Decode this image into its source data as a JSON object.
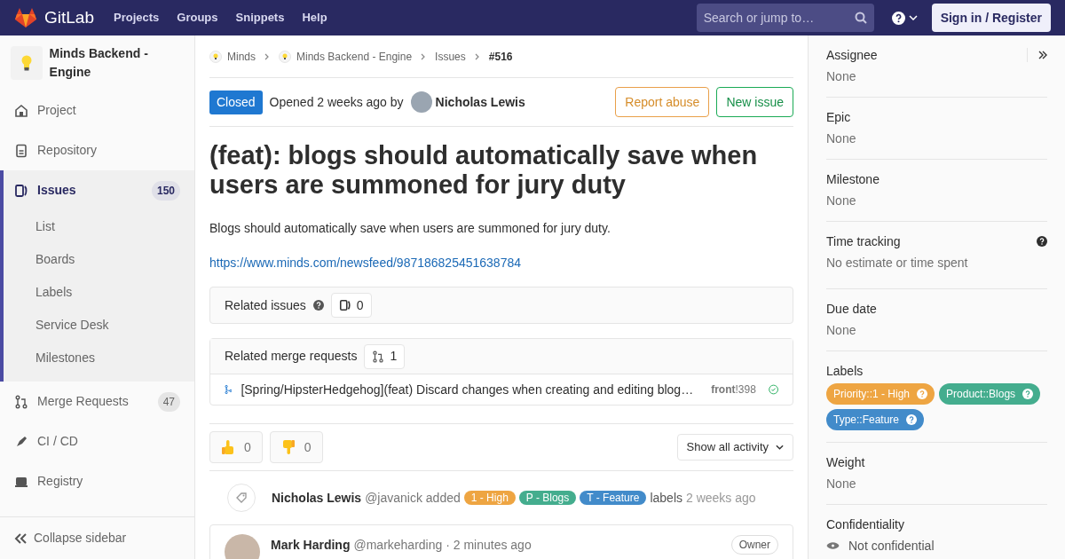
{
  "navbar": {
    "logo_text": "GitLab",
    "links": [
      "Projects",
      "Groups",
      "Snippets",
      "Help"
    ],
    "search": {
      "placeholder": "Search or jump to…"
    },
    "sign_in": "Sign in / Register"
  },
  "sidebar": {
    "project_name": "Minds Backend - Engine",
    "items": [
      {
        "kind": "project",
        "label": "Project",
        "selected": false
      },
      {
        "kind": "repository",
        "label": "Repository",
        "selected": false
      },
      {
        "kind": "issues",
        "label": "Issues",
        "count": "150",
        "selected": true,
        "children": [
          {
            "label": "List"
          },
          {
            "label": "Boards"
          },
          {
            "label": "Labels"
          },
          {
            "label": "Service Desk"
          },
          {
            "label": "Milestones"
          }
        ]
      },
      {
        "kind": "merge",
        "label": "Merge Requests",
        "count": "47",
        "selected": false
      },
      {
        "kind": "cicd",
        "label": "CI / CD",
        "selected": false
      },
      {
        "kind": "registry",
        "label": "Registry",
        "selected": false
      }
    ],
    "collapse": "Collapse sidebar"
  },
  "breadcrumbs": [
    {
      "label": "Minds",
      "kind": "project"
    },
    {
      "label": "Minds Backend - Engine",
      "kind": "project"
    },
    {
      "label": "Issues",
      "kind": "plain"
    },
    {
      "label": "#516",
      "kind": "current"
    }
  ],
  "issue": {
    "status": "Closed",
    "opened": "Opened 2 weeks ago by",
    "author": "Nicholas Lewis",
    "buttons": [
      {
        "label": "Report abuse",
        "kind": "warning"
      },
      {
        "label": "New issue",
        "kind": "success"
      }
    ],
    "title": "(feat): blogs should automatically save when users are summoned for jury duty",
    "description": "Blogs should automatically save when users are summoned for jury duty.",
    "link": "https://www.minds.com/newsfeed/987186825451638784"
  },
  "related_issues": {
    "title": "Related issues",
    "count": "0"
  },
  "related_merge_requests": {
    "title": "Related merge requests",
    "count": "1",
    "items": [
      {
        "title": "[Spring/HipsterHedgehog](feat) Discard changes when creating and editing blog…",
        "reference": "**front**!398",
        "passed": true
      }
    ]
  },
  "reactions": [
    {
      "kind": "thumbsup",
      "count": "0"
    },
    {
      "kind": "thumbsdown",
      "count": "0"
    }
  ],
  "activity_filter": "Show all activity",
  "activity": [
    {
      "author": "Nicholas Lewis",
      "handle": "@javanick",
      "action": "added",
      "labels": [
        {
          "text": "1 - High",
          "color": "#eea542"
        },
        {
          "text": "P - Blogs",
          "color": "#44ad8e"
        },
        {
          "text": "T - Feature",
          "color": "#428bca"
        }
      ],
      "suffix": "labels",
      "time": "2 weeks ago"
    }
  ],
  "comment": {
    "author": "Mark Harding",
    "handle": "@markeharding",
    "time": "· 2 minutes ago",
    "role": "Owner"
  },
  "right_sidebar": [
    {
      "kind": "text",
      "title": "Assignee",
      "value": "None"
    },
    {
      "kind": "text",
      "title": "Epic",
      "value": "None"
    },
    {
      "kind": "text",
      "title": "Milestone",
      "value": "None"
    },
    {
      "kind": "help",
      "title": "Time tracking",
      "value": "No estimate or time spent"
    },
    {
      "kind": "text",
      "title": "Due date",
      "value": "None"
    },
    {
      "kind": "labels",
      "title": "Labels",
      "labels": [
        {
          "text": "Priority::1 - High",
          "color": "#eea542"
        },
        {
          "text": "Product::Blogs",
          "color": "#44ad8e"
        },
        {
          "text": "Type::Feature",
          "color": "#428bca"
        }
      ]
    },
    {
      "kind": "text",
      "title": "Weight",
      "value": "None"
    },
    {
      "kind": "confidential",
      "title": "Confidentiality",
      "value": "Not confidential"
    }
  ]
}
